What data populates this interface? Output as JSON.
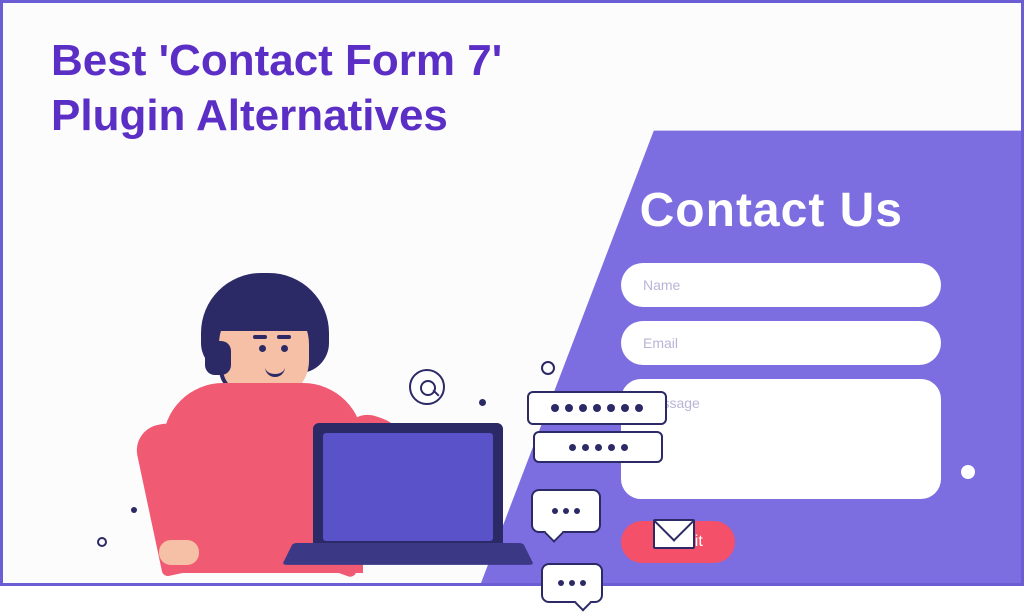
{
  "headline_line1": "Best 'Contact Form 7'",
  "headline_line2": "Plugin Alternatives",
  "contact_form": {
    "heading": "Contact Us",
    "name_placeholder": "Name",
    "email_placeholder": "Email",
    "message_placeholder": "Message",
    "submit_label": "Submit"
  }
}
